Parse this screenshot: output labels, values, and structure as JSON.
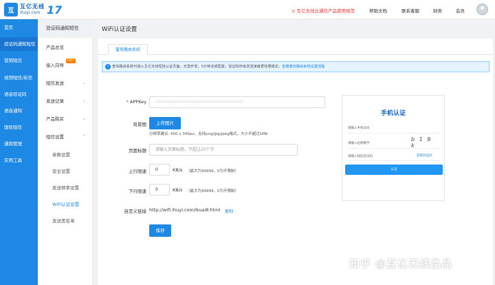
{
  "header": {
    "logo_mark": "互",
    "logo_cn": "互亿无线",
    "logo_en": "ihuyi.com",
    "logo_number": "17",
    "notice": "⊙ 互亿无线云通信产品使用规范",
    "links": [
      "帮助文档",
      "联系客服",
      "财务",
      "会员"
    ]
  },
  "nav_primary": {
    "items": [
      "首页",
      "验证码通知短信",
      "营销短信",
      "视频短信/彩信",
      "语音验证码",
      "语音通知",
      "国际短信",
      "通用管理",
      "实用工具"
    ],
    "active_index": 1
  },
  "nav_secondary": {
    "heading": "验证码通知短信",
    "product_overview": "产品总览",
    "access_guide": "接入向导",
    "hot_badge": "HOT",
    "sms_send": "短信发送",
    "send_records": "发送记录",
    "product_purchase": "产品购买",
    "sms_settings": "短信设置",
    "sub_items": [
      "参数设置",
      "安全设置",
      "发送频率设置",
      "WiFi认证设置",
      "发送黑名单"
    ],
    "active_sub_index": 3
  },
  "page": {
    "title": "WiFi认证设置",
    "tab": "蜜快路由系统",
    "info_text": "蜜快路由系统可接入互亿无线短信认证页面，无需开发，5分钟完成配置，验证码秒级发送速度更快更稳定，",
    "info_link": "查看蜜快路由系统设置流程",
    "info_icon": "info-icon"
  },
  "form": {
    "appkey_label": "APPKey",
    "appkey_value": "••••••••••••••••••••••••••••••••••••",
    "bg_label": "背景图",
    "upload_button": "上传图片",
    "upload_hint": "分辨率建议: 600 x 340px，支持png/jpg/jpeg格式，大小不超过1Mb",
    "page_title_label": "页面标题",
    "page_title_placeholder": "请输入页面标题，不超过20个字",
    "up_speed_label": "上行限速",
    "up_speed_value": "0",
    "down_speed_label": "下行限速",
    "down_speed_value": "0",
    "speed_unit": "KB/s",
    "speed_hint": "（最大为99999，0为不限制）",
    "custom_link_label": "自定义链接",
    "custom_link_value": "http://wifi.ihuyi.com/ikuai8.html",
    "copy_label": "复制",
    "save_button": "保存"
  },
  "preview": {
    "title": "手机认证",
    "phone_placeholder": "请输入手机号码",
    "captcha_placeholder": "请输入右侧数字",
    "captcha_text": "b 1 9 k",
    "sms_placeholder": "请输入短信验证码",
    "get_code": "获取验证码",
    "submit": "认证"
  },
  "watermark": "知乎 @互亿无线晶晶"
}
